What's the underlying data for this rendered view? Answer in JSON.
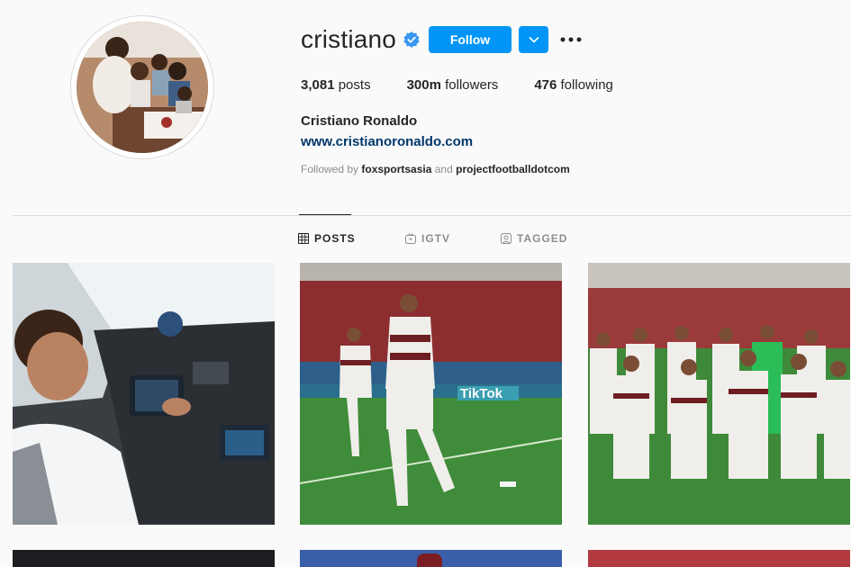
{
  "profile": {
    "username": "cristiano",
    "verified": true,
    "follow_label": "Follow",
    "posts_count": "3,081",
    "posts_label": "posts",
    "followers_count": "300m",
    "followers_label": "followers",
    "following_count": "476",
    "following_label": "following",
    "full_name": "Cristiano Ronaldo",
    "website": "www.cristianoronaldo.com",
    "followed_by_prefix": "Followed by",
    "followed_by_user1": "foxsportsasia",
    "followed_by_and": "and",
    "followed_by_user2": "projectfootballdotcom"
  },
  "tabs": [
    {
      "label": "POSTS",
      "active": true
    },
    {
      "label": "IGTV",
      "active": false
    },
    {
      "label": "TAGGED",
      "active": false
    }
  ],
  "posts": [
    {
      "overlay_text": ""
    },
    {
      "overlay_text": "TikTok"
    },
    {
      "overlay_text": ""
    }
  ],
  "colors": {
    "accent": "#0095f6",
    "link": "#00376b",
    "muted": "#8e8e8e",
    "text": "#262626",
    "verified": "#3897f0"
  }
}
